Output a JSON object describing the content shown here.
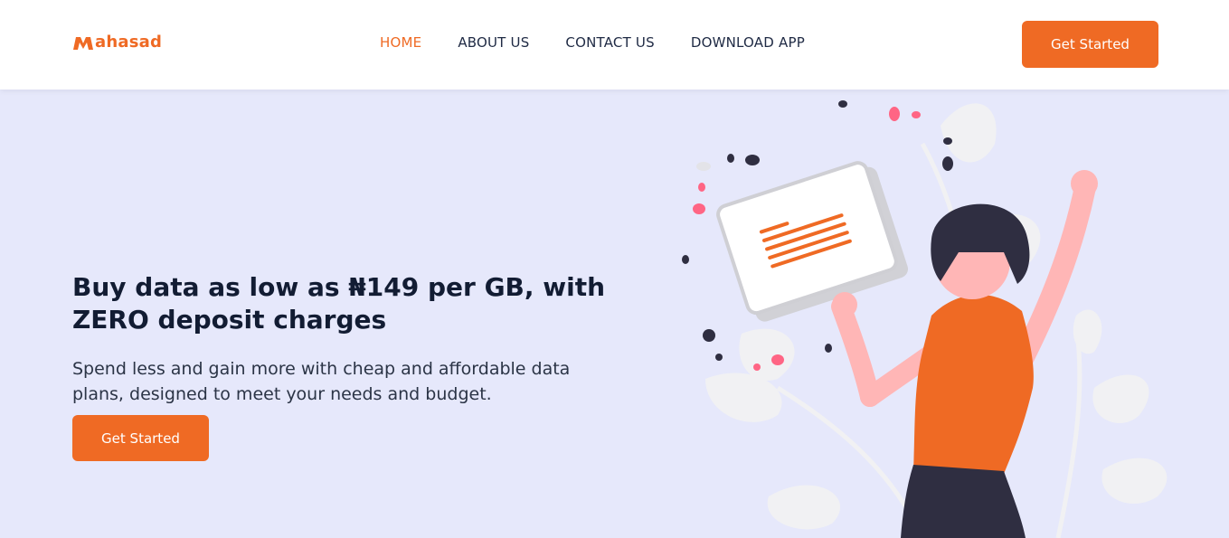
{
  "brand": {
    "name": "ahasad",
    "logo_icon": "mahasad-m-logo-icon",
    "color": "#ef6a24"
  },
  "nav": {
    "items": [
      {
        "label": "HOME",
        "active": true
      },
      {
        "label": "ABOUT US",
        "active": false
      },
      {
        "label": "CONTACT US",
        "active": false
      },
      {
        "label": "DOWNLOAD APP",
        "active": false
      }
    ]
  },
  "header": {
    "cta_label": "Get Started"
  },
  "hero": {
    "title": "Buy data as low as ₦149 per GB, with ZERO deposit charges",
    "subtitle": "Spend less and gain more with cheap and affordable data plans, designed to meet your needs and budget.",
    "cta_label": "Get Started",
    "illustration": "woman-holding-card-illustration"
  },
  "colors": {
    "accent": "#ef6a24",
    "hero_bg": "#e6e8fb",
    "text_dark": "#121c33"
  }
}
